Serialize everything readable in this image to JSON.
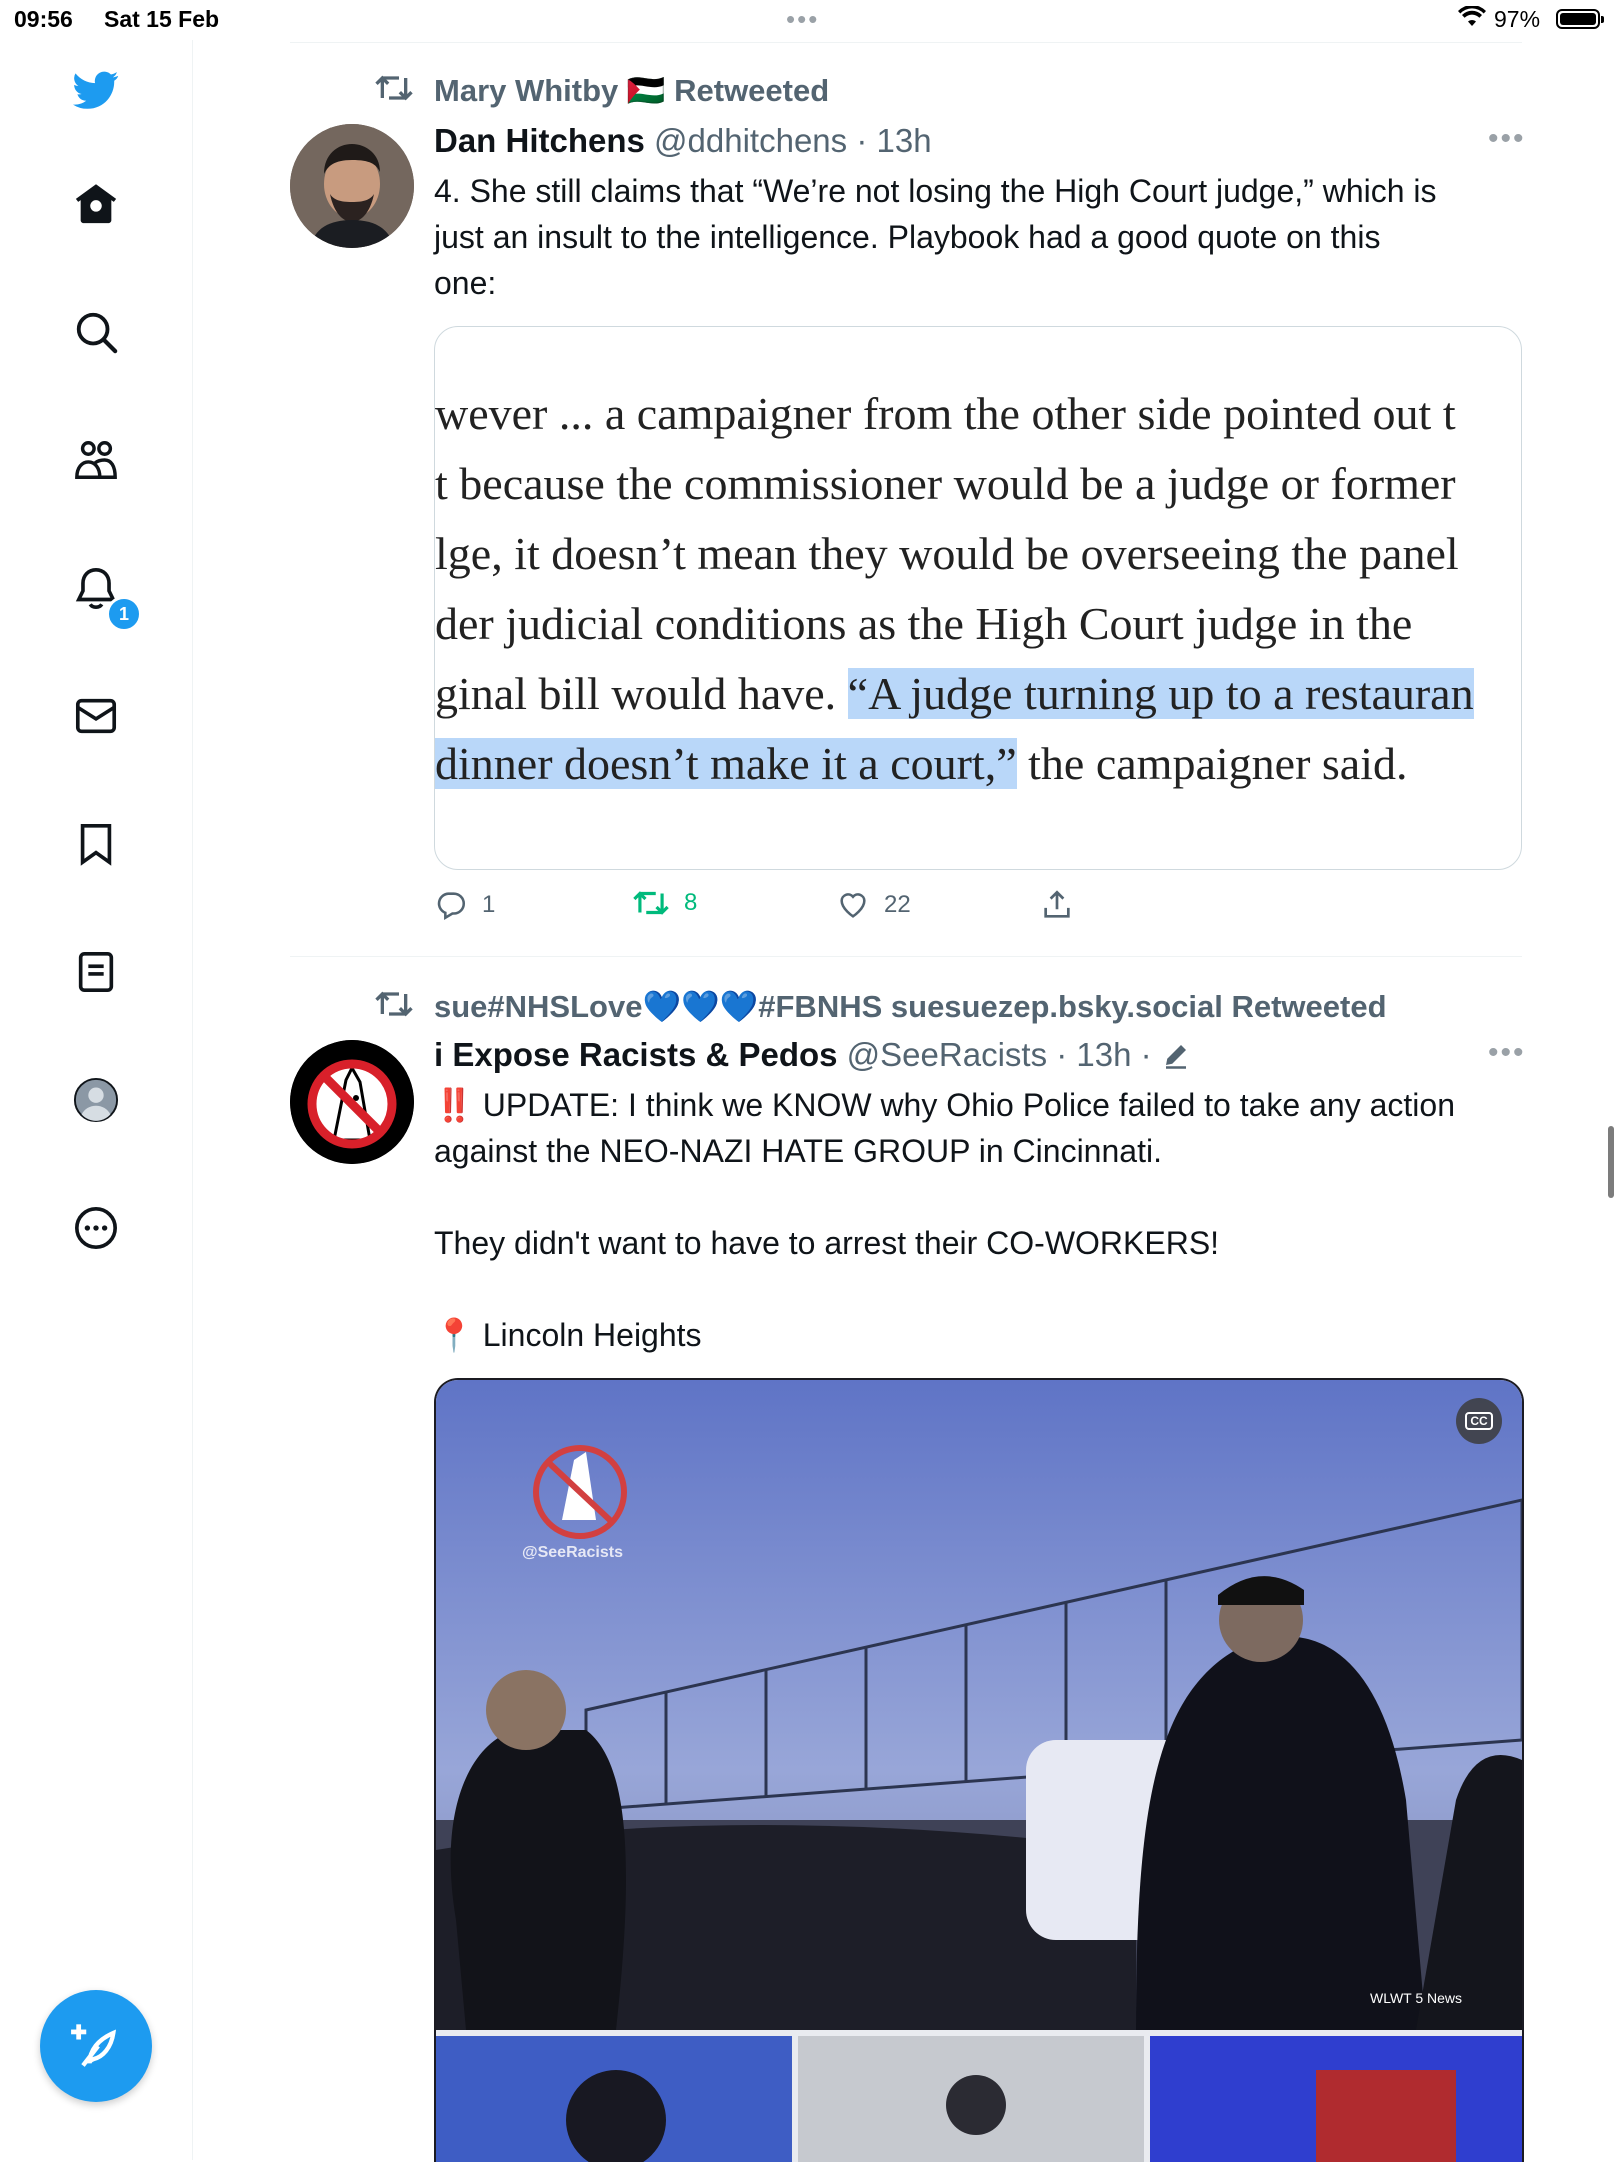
{
  "status_bar": {
    "time": "09:56",
    "date": "Sat 15 Feb",
    "battery": "97%"
  },
  "sidebar": {
    "items": [
      {
        "name": "twitter-logo-icon"
      },
      {
        "name": "home-icon"
      },
      {
        "name": "search-icon"
      },
      {
        "name": "communities-icon"
      },
      {
        "name": "notifications-icon"
      },
      {
        "name": "messages-icon"
      },
      {
        "name": "bookmarks-icon"
      },
      {
        "name": "lists-icon"
      },
      {
        "name": "profile-icon"
      },
      {
        "name": "more-icon"
      }
    ],
    "notifications_badge": "1",
    "compose_icon": "compose-tweet-icon"
  },
  "tweets": [
    {
      "retweeted_by": "Mary Whitby 🇵🇸 Retweeted",
      "author_name": "Dan Hitchens",
      "author_meta": "@ddhitchens · 13h",
      "text_lines": [
        "4. She still claims that “We’re not losing the High Court judge,” which is",
        "just an insult to the intelligence. Playbook had a good quote on this",
        "one:"
      ],
      "quote_image": {
        "lines": [
          "wever ... a campaigner from the other side pointed out t",
          "t because the commissioner would be a judge or former",
          "lge, it doesn’t mean they would be overseeing the panel",
          "der judicial conditions as the High Court judge in the"
        ],
        "line5_plain": "ginal bill would have. ",
        "line5_highlight": "“A judge turning up to a restauran",
        "line6_highlight": " dinner doesn’t make it a court,”",
        "line6_plain": " the campaigner said."
      },
      "replies": "1",
      "retweets": "8",
      "likes": "22"
    },
    {
      "retweeted_by": "sue#NHSLove💙💙💙#FBNHS suesuezep.bsky.social Retweeted",
      "author_name": "i Expose Racists & Pedos",
      "author_meta": "@SeeRacists · 13h ·",
      "text_lines": [
        "‼️ UPDATE: I think we KNOW why Ohio Police failed to take any action",
        "against the NEO-NAZI HATE GROUP in Cincinnati."
      ],
      "text_line2": "They didn't want to have to arrest their CO-WORKERS!",
      "location": "📍 Lincoln Heights",
      "video_watermark": "@SeeRacists",
      "video_source": "WLWT 5 News",
      "captions_label": "CC"
    }
  ]
}
